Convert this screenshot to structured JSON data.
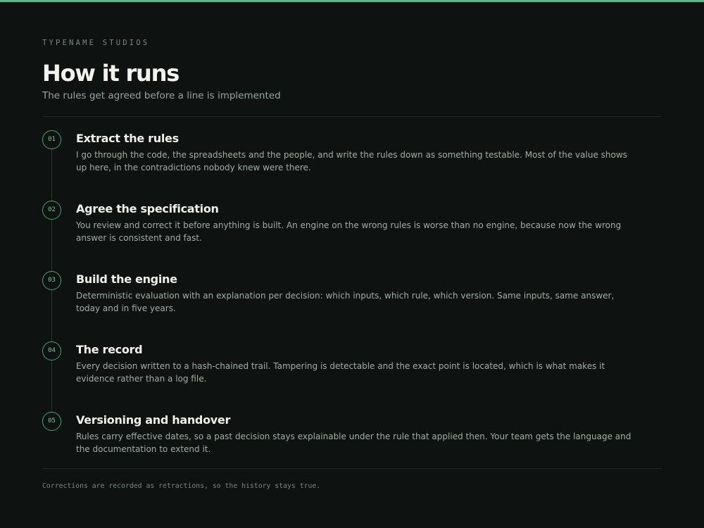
{
  "header": {
    "eyebrow": "TYPENAME STUDIOS",
    "title": "How it runs",
    "subtitle": "The rules get agreed before a line is implemented"
  },
  "steps": [
    {
      "number": "01",
      "title": "Extract the rules",
      "description": "I go through the code, the spreadsheets and the people, and write the rules down as something testable. Most of the value shows up here, in the contradictions nobody knew were there."
    },
    {
      "number": "02",
      "title": "Agree the specification",
      "description": "You review and correct it before anything is built. An engine on the wrong rules is worse than no engine, because now the wrong answer is consistent and fast."
    },
    {
      "number": "03",
      "title": "Build the engine",
      "description": "Deterministic evaluation with an explanation per decision: which inputs, which rule, which version. Same inputs, same answer, today and in five years."
    },
    {
      "number": "04",
      "title": "The record",
      "description": "Every decision written to a hash-chained trail. Tampering is detectable and the exact point is located, which is what makes it evidence rather than a log file."
    },
    {
      "number": "05",
      "title": "Versioning and handover",
      "description": "Rules carry effective dates, so a past decision stays explainable under the rule that applied then. Your team gets the language and the documentation to extend it."
    }
  ],
  "footer": {
    "note": "Corrections are recorded as retractions, so the history stays true."
  },
  "colors": {
    "accent": "#5fb88a",
    "background": "#0e1311"
  }
}
